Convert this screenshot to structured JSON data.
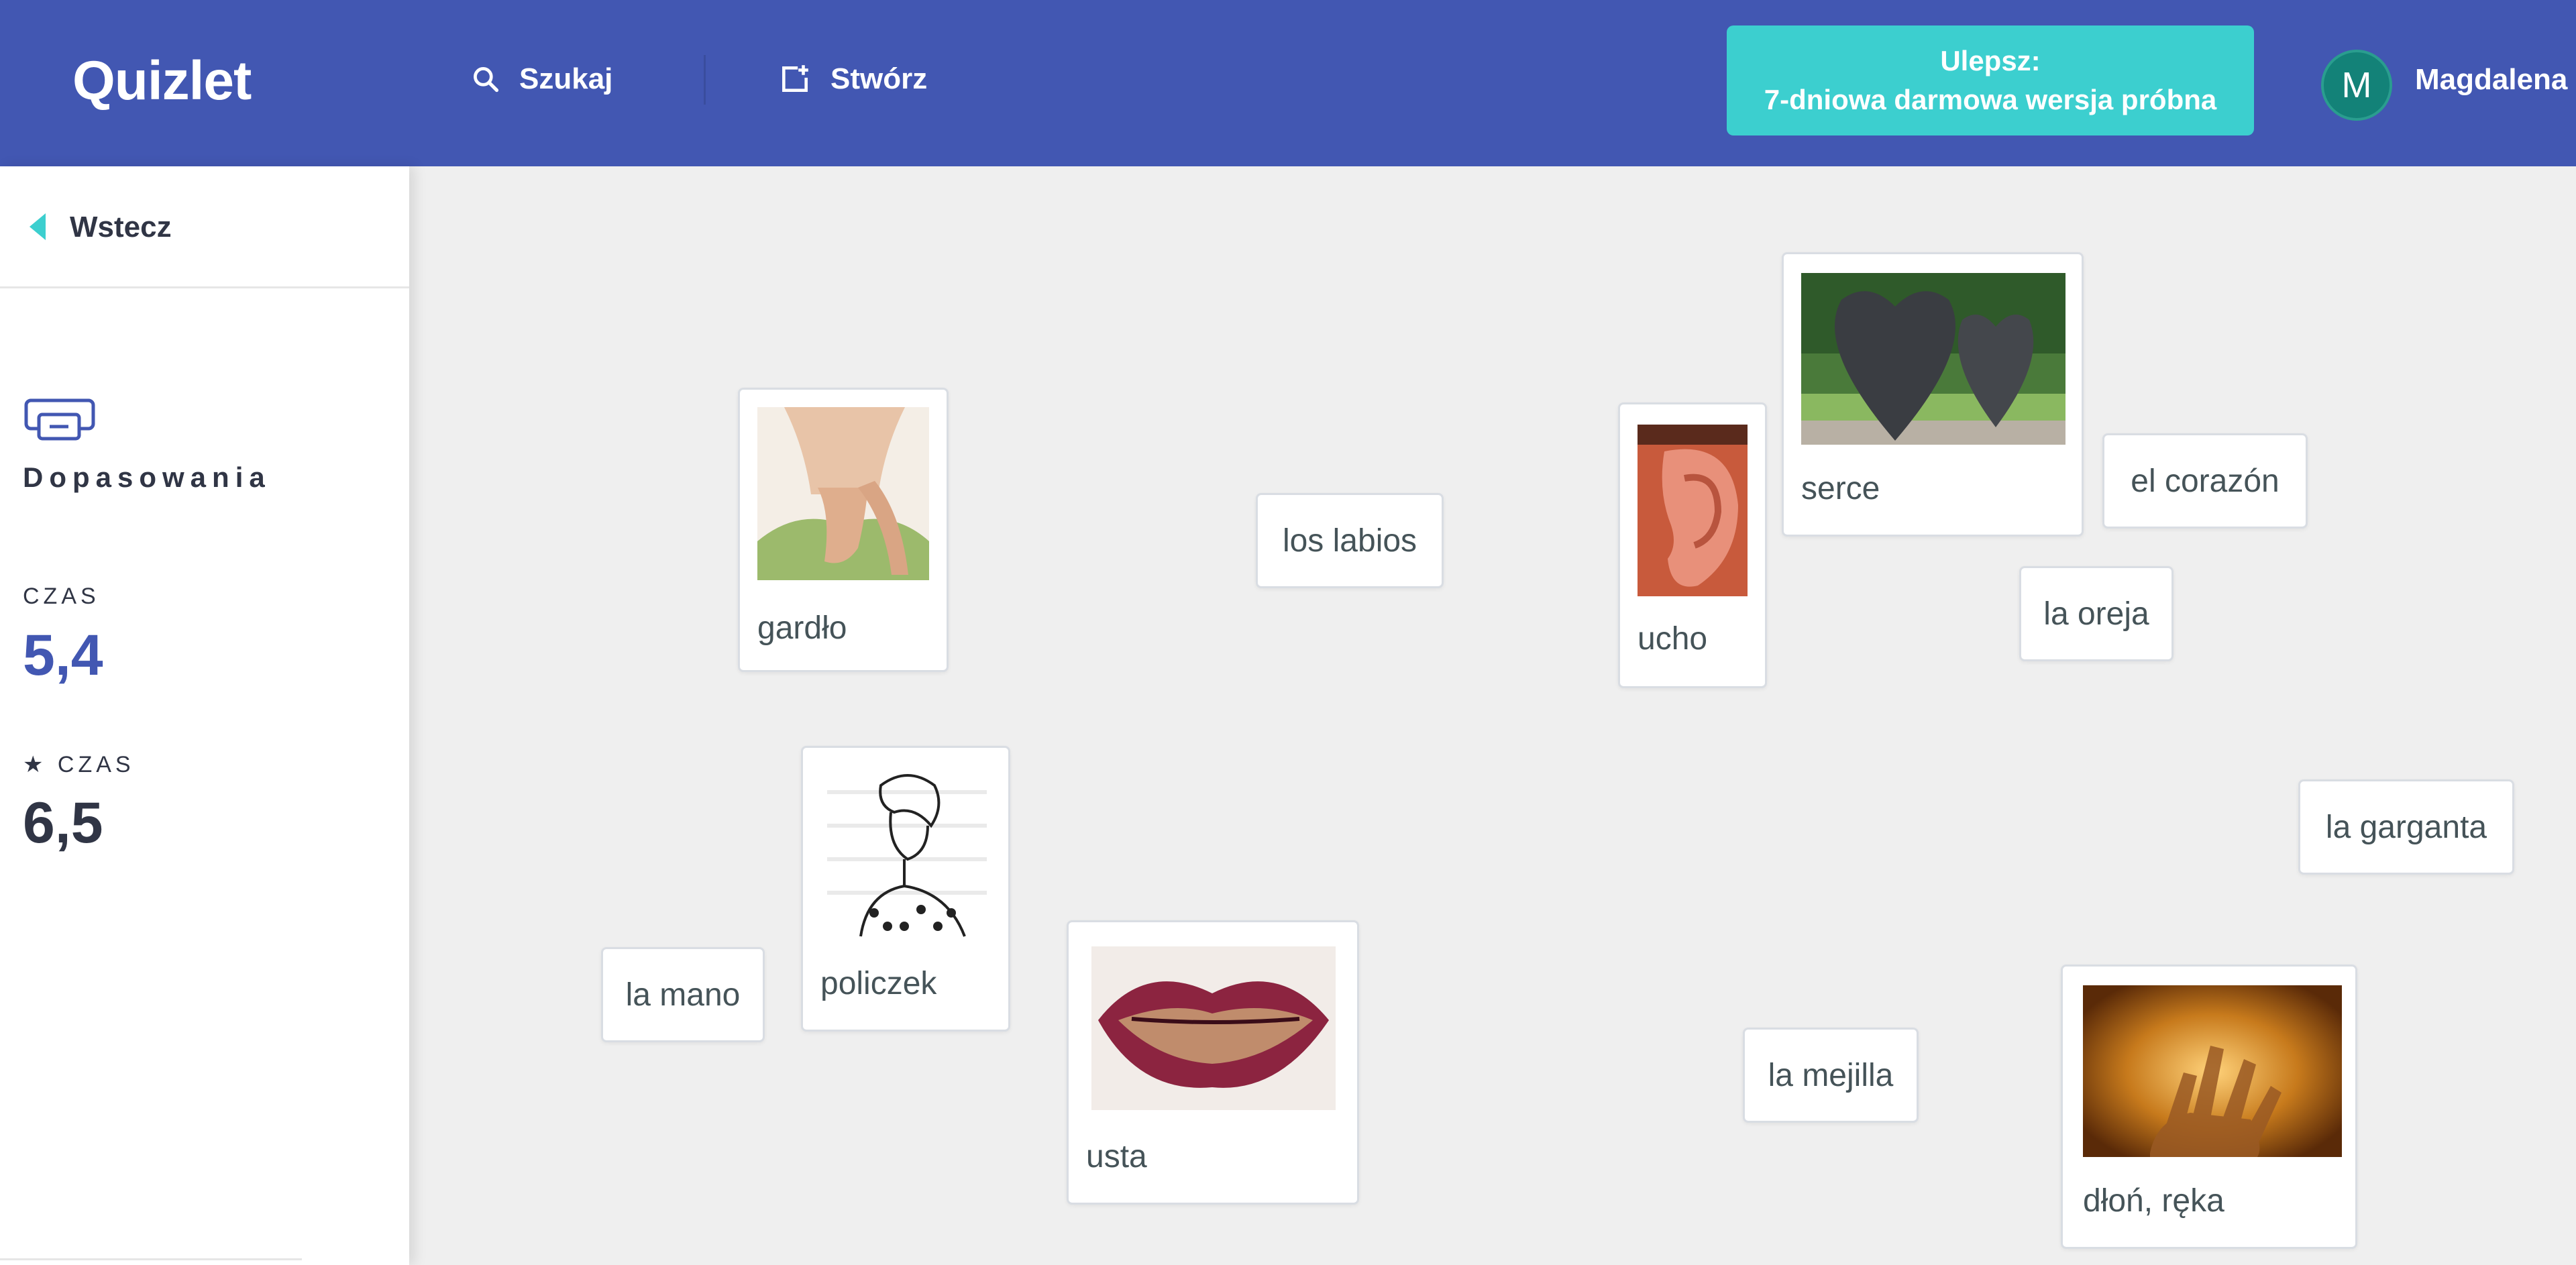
{
  "header": {
    "logo": "Quizlet",
    "search_label": "Szukaj",
    "create_label": "Stwórz",
    "upgrade_line1": "Ulepsz:",
    "upgrade_line2": "7-dniowa darmowa wersja próbna",
    "avatar_letter": "M",
    "username": "Magdalena",
    "colors": {
      "header_bg": "#4257b2",
      "upgrade_bg": "#3ccfcf",
      "avatar_bg": "#138278"
    }
  },
  "sidebar": {
    "back_label": "Wstecz",
    "mode_title": "Dopasowania",
    "time_label": "CZAS",
    "time_value": "5,4",
    "best_time_label": "★ CZAS",
    "best_time_value": "6,5"
  },
  "board": {
    "image_cards": [
      {
        "label": "gardło",
        "icon": "throat-photo"
      },
      {
        "label": "ucho",
        "icon": "ear-photo"
      },
      {
        "label": "serce",
        "icon": "hearts-sculpture-photo"
      },
      {
        "label": "policzek",
        "icon": "woman-sketch-illustration"
      },
      {
        "label": "usta",
        "icon": "lips-photo"
      },
      {
        "label": "dłoń, ręka",
        "icon": "hand-photo"
      }
    ],
    "word_cards": [
      {
        "label": "los labios"
      },
      {
        "label": "el corazón"
      },
      {
        "label": "la oreja"
      },
      {
        "label": "la garganta"
      },
      {
        "label": "la mano"
      },
      {
        "label": "la mejilla"
      }
    ]
  }
}
